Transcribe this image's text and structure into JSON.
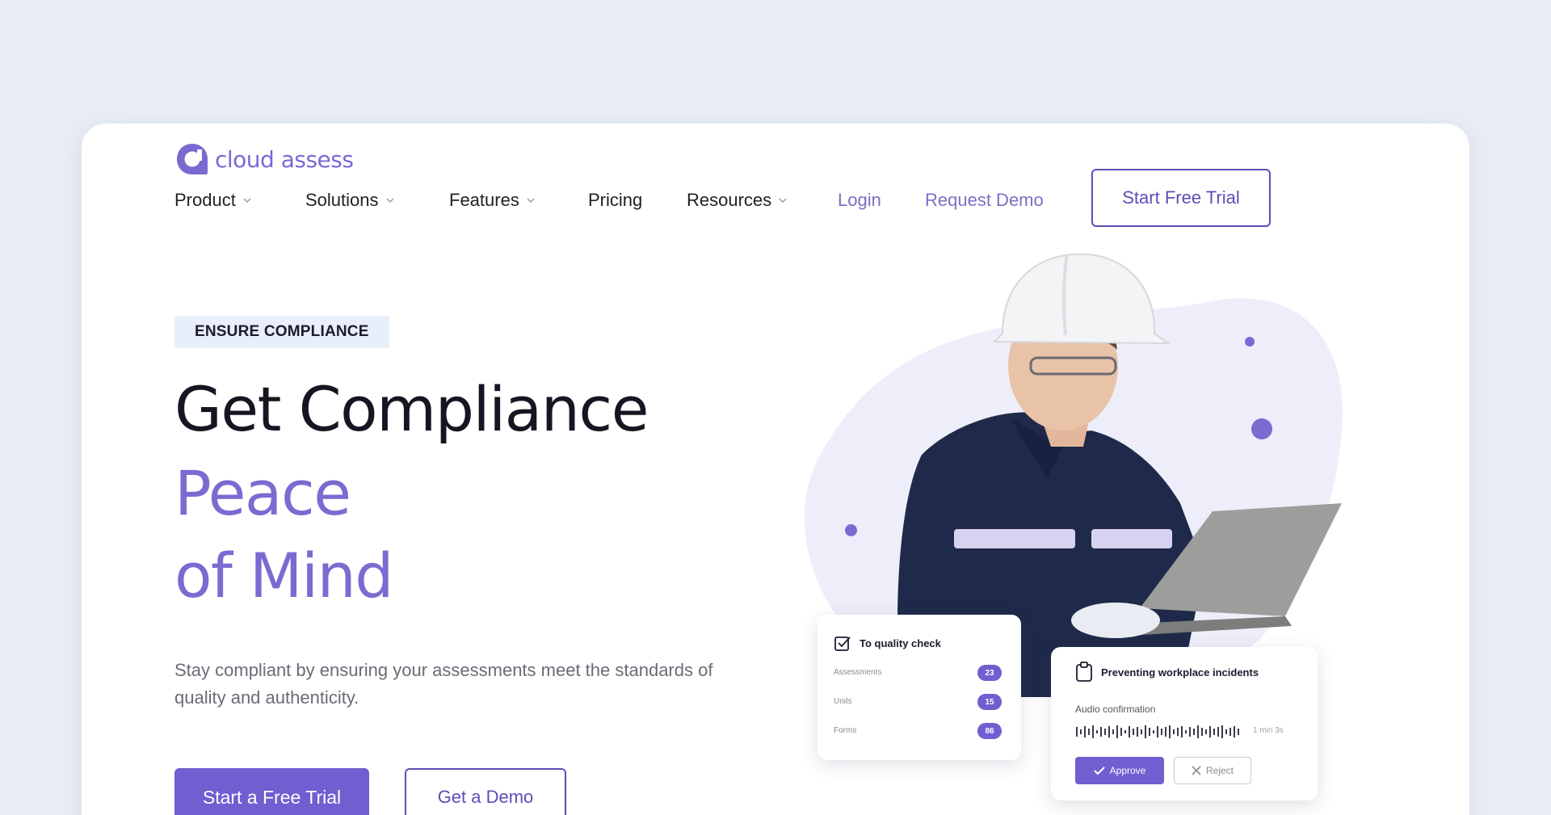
{
  "brand": {
    "name": "cloud assess",
    "accent_color": "#7a6bd1"
  },
  "nav": {
    "items": [
      {
        "label": "Product",
        "has_dropdown": true
      },
      {
        "label": "Solutions",
        "has_dropdown": true
      },
      {
        "label": "Features",
        "has_dropdown": true
      },
      {
        "label": "Pricing",
        "has_dropdown": false
      },
      {
        "label": "Resources",
        "has_dropdown": true
      }
    ],
    "login": "Login",
    "request_demo": "Request Demo",
    "start_free_trial": "Start Free Trial"
  },
  "hero": {
    "tag": "ENSURE COMPLIANCE",
    "title_line1": "Get Compliance",
    "title_line2": "Peace",
    "title_line3": "of Mind",
    "subtitle": "Stay compliant by ensuring your assessments meet the standards of quality and authenticity.",
    "cta_primary": "Start a Free Trial",
    "cta_secondary": "Get a Demo"
  },
  "quality_card": {
    "title": "To quality check",
    "rows": [
      {
        "label": "Assessments",
        "count": "23"
      },
      {
        "label": "Units",
        "count": "15"
      },
      {
        "label": "Forms",
        "count": "86"
      }
    ]
  },
  "incident_card": {
    "title": "Preventing workplace incidents",
    "audio_label": "Audio confirmation",
    "duration": "1 min 3s",
    "approve": "Approve",
    "reject": "Reject"
  }
}
